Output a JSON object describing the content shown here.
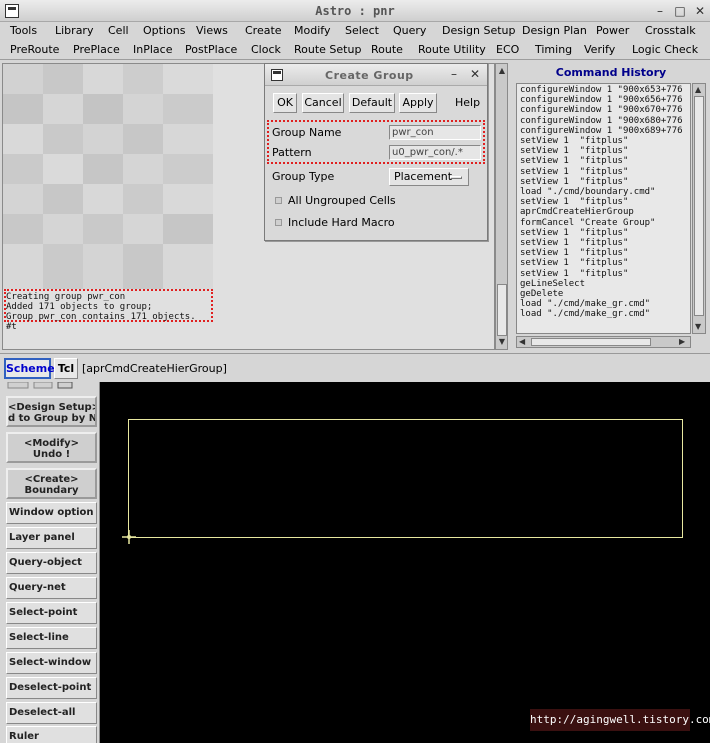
{
  "window": {
    "title": "Astro : pnr"
  },
  "menubar1": [
    "Tools",
    "Library",
    "Cell",
    "Options",
    "Views",
    "Create",
    "Modify",
    "Select",
    "Query",
    "Design Setup",
    "Design Plan",
    "Power",
    "Crosstalk"
  ],
  "menubar2": [
    "PreRoute",
    "PrePlace",
    "InPlace",
    "PostPlace",
    "Clock",
    "Route Setup",
    "Route",
    "Route Utility",
    "ECO",
    "Timing",
    "Verify",
    "Logic Check"
  ],
  "messages": [
    "Creating group pwr_con",
    "Added 171 objects to group;",
    "Group pwr_con contains 171 objects.",
    "#t"
  ],
  "dialog": {
    "title": "Create Group",
    "buttons": [
      "OK",
      "Cancel",
      "Default",
      "Apply",
      "Help"
    ],
    "group_name_label": "Group Name",
    "group_name_value": "pwr_con",
    "pattern_label": "Pattern",
    "pattern_value": "u0_pwr_con/.*",
    "group_type_label": "Group Type",
    "group_type_value": "Placement",
    "check1_label": "All Ungrouped Cells",
    "check2_label": "Include Hard Macro"
  },
  "history": {
    "title": "Command History",
    "lines": [
      "configureWindow 1 \"900x653+776",
      "configureWindow 1 \"900x656+776",
      "configureWindow 1 \"900x670+776",
      "configureWindow 1 \"900x680+776",
      "configureWindow 1 \"900x689+776",
      "setView 1  \"fitplus\"",
      "setView 1  \"fitplus\"",
      "setView 1  \"fitplus\"",
      "setView 1  \"fitplus\"",
      "setView 1  \"fitplus\"",
      "load \"./cmd/boundary.cmd\"",
      "setView 1  \"fitplus\"",
      "aprCmdCreateHierGroup",
      "formCancel \"Create Group\"",
      "setView 1  \"fitplus\"",
      "setView 1  \"fitplus\"",
      "setView 1  \"fitplus\"",
      "setView 1  \"fitplus\"",
      "setView 1  \"fitplus\"",
      "geLineSelect",
      "geDelete",
      "load \"./cmd/make_gr.cmd\"",
      "load \"./cmd/make_gr.cmd\""
    ]
  },
  "cmdbar": {
    "scheme": "Scheme",
    "tcl": "Tcl",
    "text": "[aprCmdCreateHierGroup]"
  },
  "sidebar": {
    "big": [
      [
        "<Design Setup>",
        "d to Group by Name"
      ],
      [
        "<Modify>",
        "Undo !"
      ],
      [
        "<Create>",
        "Boundary"
      ]
    ],
    "small": [
      "Window option",
      "Layer panel",
      "Query-object",
      "Query-net",
      "Select-point",
      "Select-line",
      "Select-window",
      "Deselect-point",
      "Deselect-all",
      "Ruler"
    ]
  },
  "watermark": "http://agingwell.tistory.com",
  "colors": {
    "accent_red": "#e02020",
    "history_title": "#00008b",
    "canvas_bg": "#000000",
    "boundary": "#e8e8a0"
  }
}
